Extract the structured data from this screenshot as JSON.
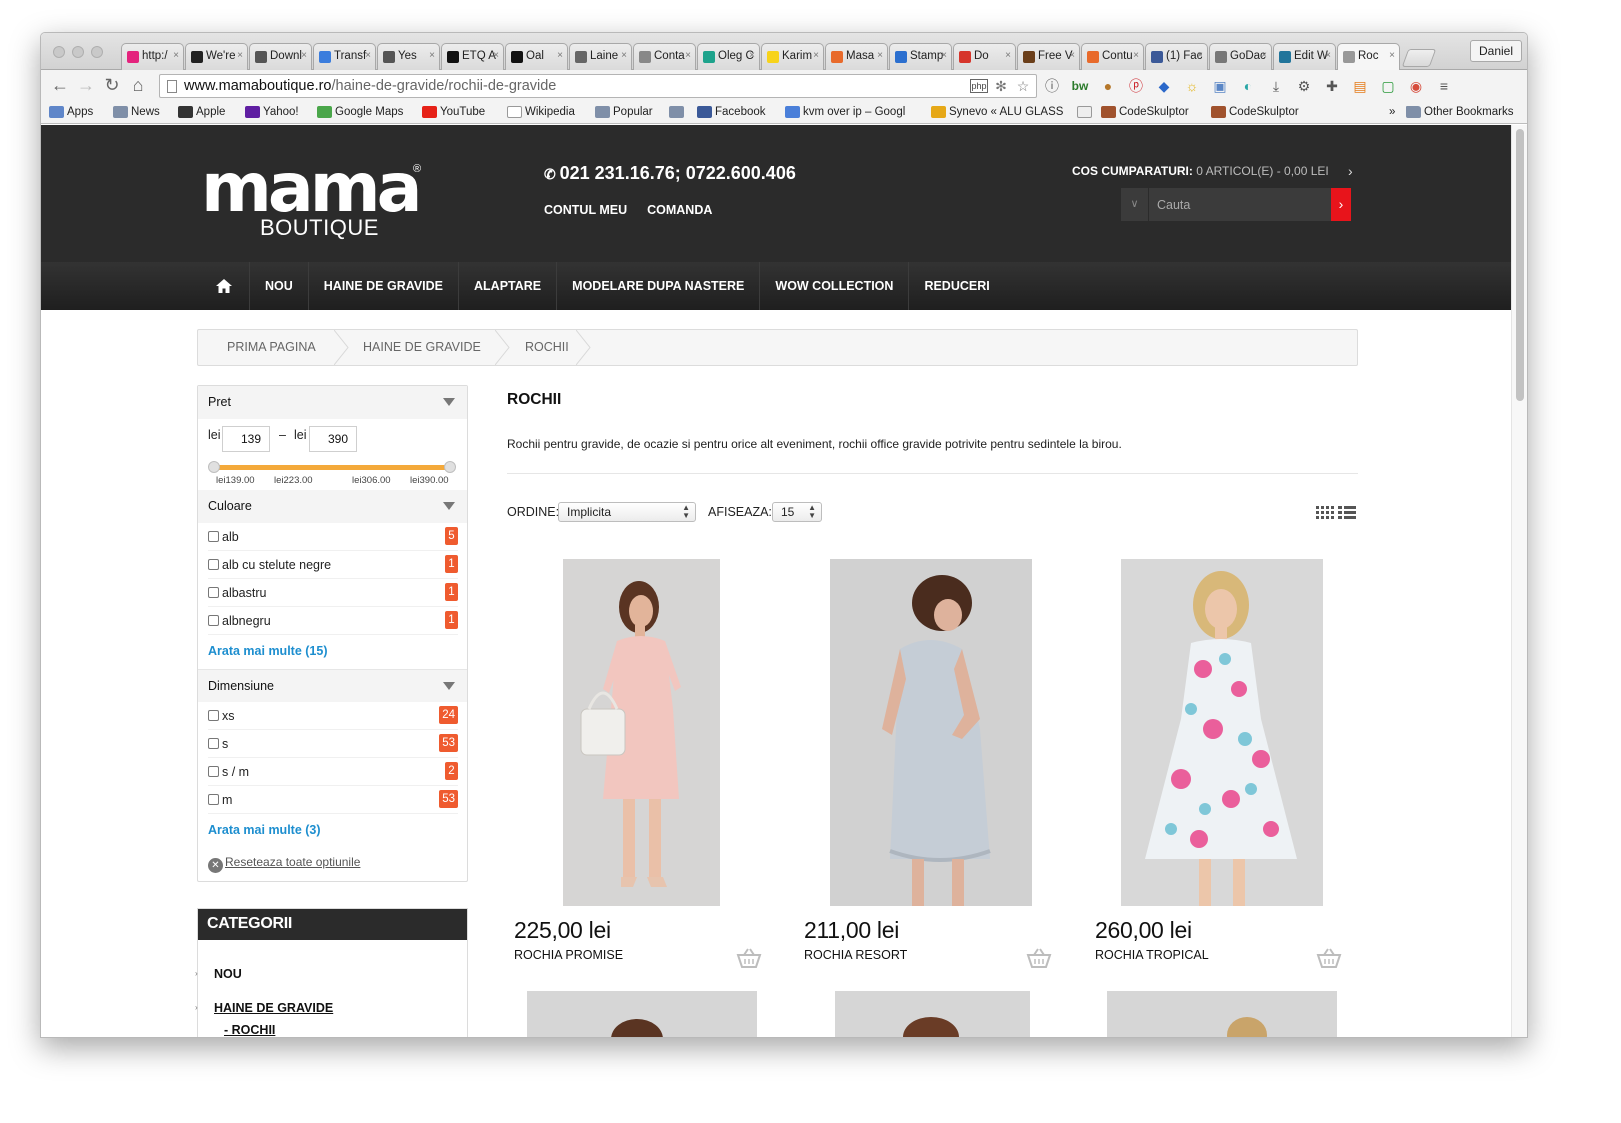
{
  "browser": {
    "tabs": [
      {
        "label": "http:/",
        "icon_color": "#e4237d"
      },
      {
        "label": "We're",
        "icon_color": "#222222"
      },
      {
        "label": "Downl",
        "icon_color": "#555555"
      },
      {
        "label": "Transf",
        "icon_color": "#3b7ddd"
      },
      {
        "label": "Yes",
        "icon_color": "#555555"
      },
      {
        "label": "ETQ A",
        "icon_color": "#111111"
      },
      {
        "label": "Oal",
        "icon_color": "#111111"
      },
      {
        "label": "Laine",
        "icon_color": "#666666"
      },
      {
        "label": "Conta",
        "icon_color": "#888888"
      },
      {
        "label": "Oleg C",
        "icon_color": "#1ea38c"
      },
      {
        "label": "Karim",
        "icon_color": "#f7d31b"
      },
      {
        "label": "Masa",
        "icon_color": "#e86a2b"
      },
      {
        "label": "Stamp",
        "icon_color": "#2b6fcf"
      },
      {
        "label": "Do",
        "icon_color": "#d6352b"
      },
      {
        "label": "Free V",
        "icon_color": "#6b3f1a"
      },
      {
        "label": "Contu",
        "icon_color": "#e86a2b"
      },
      {
        "label": "(1) Fac",
        "icon_color": "#3b5998"
      },
      {
        "label": "GoDac",
        "icon_color": "#777777"
      },
      {
        "label": "Edit W",
        "icon_color": "#21759b"
      },
      {
        "label": "Roc",
        "icon_color": "#999999"
      }
    ],
    "user": "Daniel",
    "url_host": "www.mamaboutique.ro",
    "url_path": "/haine-de-gravide/rochii-de-gravide",
    "bookmarks": [
      {
        "label": "Apps",
        "icon_color": "#5f86c9"
      },
      {
        "label": "News",
        "icon_color": "#7f8fa8"
      },
      {
        "label": "Apple",
        "icon_color": "#333333"
      },
      {
        "label": "Yahoo!",
        "icon_color": "#5f1ea2"
      },
      {
        "label": "Google Maps",
        "icon_color": "#4aa64a"
      },
      {
        "label": "YouTube",
        "icon_color": "#e62117"
      },
      {
        "label": "Wikipedia",
        "icon_color": "#ffffff"
      },
      {
        "label": "Popular",
        "icon_color": "#7f8fa8"
      },
      {
        "label": "",
        "icon_color": "#7f8fa8"
      },
      {
        "label": "Facebook",
        "icon_color": "#3b5998"
      },
      {
        "label": "kvm over ip – Googl",
        "icon_color": "#4a7fd9"
      },
      {
        "label": "Synevo « ALU GLASS",
        "icon_color": "#e6a817"
      },
      {
        "label": "",
        "icon_color": "#eeeeee"
      },
      {
        "label": "CodeSkulptor",
        "icon_color": "#a0522d"
      },
      {
        "label": "CodeSkulptor",
        "icon_color": "#a0522d"
      }
    ],
    "more_bookmarks": "»",
    "other_bookmarks": "Other Bookmarks"
  },
  "site": {
    "logo_main": "mama",
    "logo_sub": "BOUTIQUE",
    "logo_reg": "®",
    "phone": "021 231.16.76; 0722.600.406",
    "top_links": [
      "CONTUL MEU",
      "COMANDA"
    ],
    "cart_label": "COS CUMPARATURI:",
    "cart_value": "0 ARTICOL(E) - 0,00 LEI",
    "search_placeholder": "Cauta",
    "nav": [
      "NOU",
      "HAINE DE GRAVIDE",
      "ALAPTARE",
      "MODELARE DUPA NASTERE",
      "WOW COLLECTION",
      "REDUCERI"
    ],
    "breadcrumb": [
      "PRIMA PAGINA",
      "HAINE DE GRAVIDE",
      "ROCHII"
    ]
  },
  "filters": {
    "price": {
      "title": "Pret",
      "currency": "lei",
      "separator": "–",
      "min": "139",
      "max": "390",
      "ticks": [
        "lei139.00",
        "lei223.00",
        "lei306.00",
        "lei390.00"
      ]
    },
    "color": {
      "title": "Culoare",
      "options": [
        {
          "label": "alb",
          "count": "5"
        },
        {
          "label": "alb cu stelute negre",
          "count": "1"
        },
        {
          "label": "albastru",
          "count": "1"
        },
        {
          "label": "albnegru",
          "count": "1"
        }
      ],
      "more": "Arata mai multe (15)"
    },
    "size": {
      "title": "Dimensiune",
      "options": [
        {
          "label": "xs",
          "count": "24"
        },
        {
          "label": "s",
          "count": "53"
        },
        {
          "label": "s / m",
          "count": "2"
        },
        {
          "label": "m",
          "count": "53"
        }
      ],
      "more": "Arata mai multe (3)"
    },
    "reset": "Reseteaza toate optiunile"
  },
  "categories": {
    "title": "CATEGORII",
    "items": [
      "NOU",
      "HAINE DE GRAVIDE",
      "- ROCHII"
    ]
  },
  "main": {
    "title": "ROCHII",
    "description": "Rochii pentru gravide, de ocazie si pentru orice alt eveniment, rochii office gravide potrivite pentru sedintele la birou.",
    "order_label": "ORDINE:",
    "order_value": "Implicita",
    "show_label": "AFISEAZA:",
    "show_value": "15",
    "products": [
      {
        "price": "225,00 lei",
        "name": "ROCHIA PROMISE"
      },
      {
        "price": "211,00 lei",
        "name": "ROCHIA RESORT"
      },
      {
        "price": "260,00 lei",
        "name": "ROCHIA TROPICAL"
      }
    ]
  }
}
